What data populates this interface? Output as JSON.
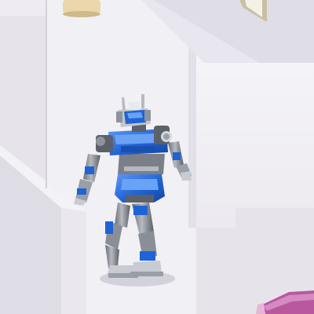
{
  "scene": {
    "description_label": "",
    "colors": {
      "floor": "#e9e7ee",
      "wall_light": "#f6f5f9",
      "wall_shadow": "#d8d6de",
      "robot_blue": "#1f63d6",
      "robot_blue_light": "#4d8df0",
      "robot_gray": "#8f939b",
      "robot_gray_dark": "#5c6068",
      "robot_white": "#f2f3f6",
      "lamp_base": "#ead7ab",
      "rug": "#b9589f",
      "rug_light": "#d58ac3",
      "frame_edge": "#c9bfa4"
    }
  }
}
